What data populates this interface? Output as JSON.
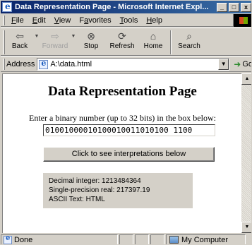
{
  "window": {
    "title": "Data Representation Page - Microsoft Internet Expl...",
    "minimize": "_",
    "maximize": "□",
    "close": "x"
  },
  "menu": {
    "items": [
      {
        "label": "File",
        "key": "F"
      },
      {
        "label": "Edit",
        "key": "E"
      },
      {
        "label": "View",
        "key": "V"
      },
      {
        "label": "Favorites",
        "key": "a"
      },
      {
        "label": "Tools",
        "key": "T"
      },
      {
        "label": "Help",
        "key": "H"
      }
    ]
  },
  "toolbar": {
    "back": {
      "label": "Back",
      "icon": "back-arrow-icon"
    },
    "forward": {
      "label": "Forward",
      "icon": "forward-arrow-icon"
    },
    "stop": {
      "label": "Stop",
      "icon": "stop-icon"
    },
    "refresh": {
      "label": "Refresh",
      "icon": "refresh-icon"
    },
    "home": {
      "label": "Home",
      "icon": "home-icon"
    },
    "search": {
      "label": "Search",
      "icon": "search-icon"
    }
  },
  "address": {
    "label": "Address",
    "value": "A:\\data.html",
    "go_label": "Go"
  },
  "page": {
    "title": "Data Representation Page",
    "prompt": "Enter a binary number (up to 32 bits) in the box below:",
    "binary_value": "01001000010100010011010100 1100",
    "button_label": "Click to see interpretations below",
    "results": {
      "decimal": "Decimal integer:  1213484364",
      "real": "Single-precision real:  217397.19",
      "ascii": "ASCII Text:  HTML"
    }
  },
  "status": {
    "text": "Done",
    "zone": "My Computer"
  },
  "colors": {
    "titlebar_start": "#0a246a",
    "titlebar_end": "#3a6ea5",
    "chrome": "#d4d0c8",
    "results_bg": "#d4d0c8"
  }
}
